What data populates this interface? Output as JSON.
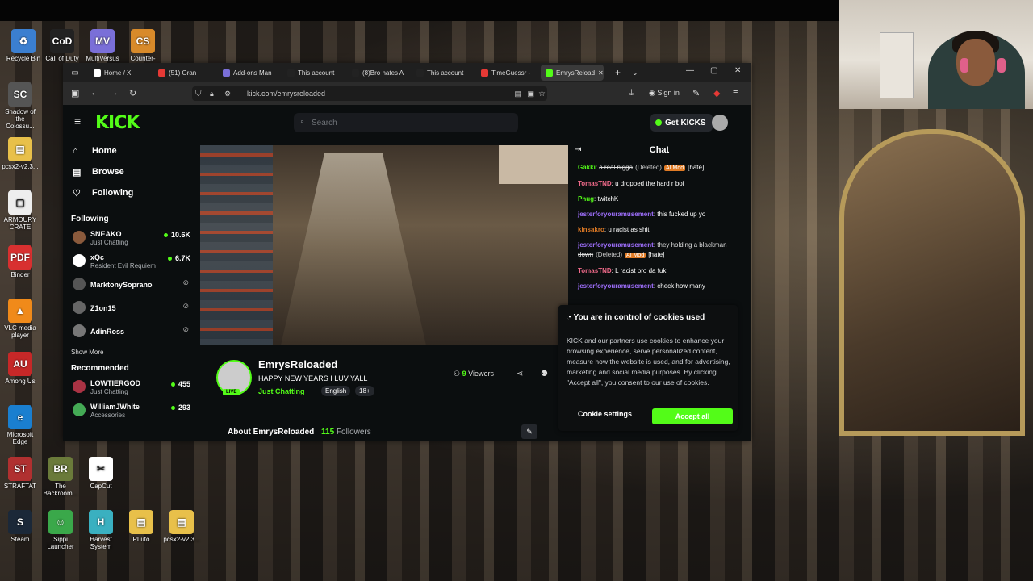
{
  "desktop_icons": [
    {
      "label": "Recycle Bin",
      "color": "#3b7fd0",
      "glyph": "♻"
    },
    {
      "label": "Call of Duty",
      "color": "#222222",
      "glyph": "CoD"
    },
    {
      "label": "MultiVersus",
      "color": "#7a6fd8",
      "glyph": "MV"
    },
    {
      "label": "Counter-Str...",
      "color": "#d88a2a",
      "glyph": "CS"
    },
    {
      "label": "Shadow of the Colossu...",
      "color": "#555555",
      "glyph": "SC"
    },
    {
      "label": "pcsx2-v2.3...",
      "color": "#e8c04a",
      "glyph": "▤"
    },
    {
      "label": "ARMOURY CRATE",
      "color": "#eeeeee",
      "glyph": "▢"
    },
    {
      "label": "Binder",
      "color": "#d83030",
      "glyph": "PDF"
    },
    {
      "label": "VLC media player",
      "color": "#f08a1a",
      "glyph": "▲"
    },
    {
      "label": "Among Us",
      "color": "#c62828",
      "glyph": "AU"
    },
    {
      "label": "Microsoft Edge",
      "color": "#1a7fd0",
      "glyph": "e"
    },
    {
      "label": "STRAFTAT",
      "color": "#b03030",
      "glyph": "ST"
    },
    {
      "label": "The Backroom...",
      "color": "#6a7a3a",
      "glyph": "BR"
    },
    {
      "label": "CapCut",
      "color": "#ffffff",
      "glyph": "✂"
    },
    {
      "label": "Steam",
      "color": "#1b2838",
      "glyph": "S"
    },
    {
      "label": "Sippi Launcher",
      "color": "#3aa84a",
      "glyph": "☺"
    },
    {
      "label": "Harvest System",
      "color": "#3ab0c0",
      "glyph": "H"
    },
    {
      "label": "PLuto",
      "color": "#e8c04a",
      "glyph": "▤"
    },
    {
      "label": "pcsx2-v2.3...",
      "color": "#e8c04a",
      "glyph": "▤"
    }
  ],
  "browser": {
    "tabs": [
      {
        "label": "Home / X",
        "color": "#ffffff"
      },
      {
        "label": "(51) Gran",
        "color": "#e53935"
      },
      {
        "label": "Add-ons Man",
        "color": "#7a6fd8"
      },
      {
        "label": "This account",
        "color": "#222222"
      },
      {
        "label": "(8)Bro hates A",
        "color": "#222222"
      },
      {
        "label": "This account",
        "color": "#222222"
      },
      {
        "label": "TimeGuessr -",
        "color": "#e53935"
      },
      {
        "label": "EmrysReload",
        "color": "#53fc18"
      }
    ],
    "url": "kick.com/emrysreloaded",
    "sign_in": "Sign in"
  },
  "kick": {
    "logo": "KICK",
    "search_placeholder": "Search",
    "get_kicks": "Get KICKS",
    "nav": [
      {
        "label": "Home",
        "icon": "⌂"
      },
      {
        "label": "Browse",
        "icon": "▤"
      },
      {
        "label": "Following",
        "icon": "♡"
      }
    ],
    "following_header": "Following",
    "following": [
      {
        "name": "SNEAKO",
        "sub": "Just Chatting",
        "viewers": "10.6K",
        "color": "#8a5a3c"
      },
      {
        "name": "xQc",
        "sub": "Resident Evil Requiem",
        "viewers": "6.7K",
        "color": "#ffffff"
      },
      {
        "name": "MarktonySoprano",
        "sub": "",
        "viewers": "",
        "color": "#555555"
      },
      {
        "name": "Z1on15",
        "sub": "",
        "viewers": "",
        "color": "#666666"
      },
      {
        "name": "AdinRoss",
        "sub": "",
        "viewers": "",
        "color": "#777777"
      }
    ],
    "show_more": "Show More",
    "recommended_header": "Recommended",
    "recommended": [
      {
        "name": "LOWTIERGOD",
        "sub": "Just Chatting",
        "viewers": "455",
        "color": "#aa3344"
      },
      {
        "name": "WilliamJWhite",
        "sub": "Accessories",
        "viewers": "293",
        "color": "#44aa55"
      }
    ],
    "streamer": {
      "name": "EmrysReloaded",
      "title": "HAPPY NEW YEARS I LUV YALL",
      "category": "Just Chatting",
      "tags": [
        "English",
        "18+"
      ],
      "viewers_count": "9",
      "viewers_label": "Viewers",
      "live": "LIVE"
    },
    "about": {
      "label": "About EmrysReloaded",
      "followers_count": "115",
      "followers_label": "Followers"
    },
    "chat": {
      "title": "Chat",
      "messages": [
        {
          "user": "Gakki",
          "color": "#53fc18",
          "text": "a real nigga",
          "struck": true,
          "deleted": "(Deleted)",
          "badge": "AI Mod",
          "tag": "[hate]"
        },
        {
          "user": "TomasTND",
          "color": "#f06a8a",
          "text": "u dropped the hard r boi"
        },
        {
          "user": "Phug",
          "color": "#53fc18",
          "text": "twitchK"
        },
        {
          "user": "jesterforyouramusement",
          "color": "#a070ff",
          "text": "this fucked up yo"
        },
        {
          "user": "kinsakro",
          "color": "#e07b25",
          "text": "u racist as shit"
        },
        {
          "user": "jesterforyouramusement",
          "color": "#a070ff",
          "text": "they holding a blackman down",
          "struck": true,
          "deleted": "(Deleted)",
          "badge": "AI Mod",
          "tag": "[hate]"
        },
        {
          "user": "TomasTND",
          "color": "#f06a8a",
          "text": "L racist bro da fuk"
        },
        {
          "user": "jesterforyouramusement",
          "color": "#a070ff",
          "text": "check how many"
        }
      ]
    },
    "cookie": {
      "title": "You are in control of cookies used",
      "body": "KICK and our partners use cookies to enhance your browsing experience, serve personalized content, measure how the website is used, and for advertising, marketing and social media purposes. By clicking \"Accept all\", you consent to our use of cookies.",
      "settings": "Cookie settings",
      "accept": "Accept all"
    }
  }
}
